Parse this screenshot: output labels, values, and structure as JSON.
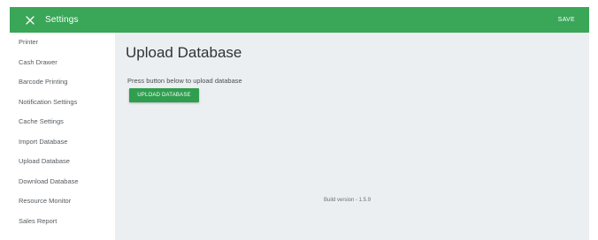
{
  "header": {
    "title": "Settings",
    "save_label": "SAVE",
    "close_icon": "close-icon"
  },
  "sidebar": {
    "items": [
      {
        "label": "Printer"
      },
      {
        "label": "Cash Drawer"
      },
      {
        "label": "Barcode Printing"
      },
      {
        "label": "Notification Settings"
      },
      {
        "label": "Cache Settings"
      },
      {
        "label": "Import Database"
      },
      {
        "label": "Upload Database"
      },
      {
        "label": "Download Database"
      },
      {
        "label": "Resource Monitor"
      },
      {
        "label": "Sales Report"
      }
    ]
  },
  "main": {
    "title": "Upload Database",
    "instruction": "Press button below to upload database",
    "upload_button_label": "UPLOAD DATABASE",
    "build_version": "Build version - 1.5.9"
  },
  "colors": {
    "topbar": "#3aa657",
    "button": "#2f9e4f",
    "content_bg": "#eceff1"
  }
}
